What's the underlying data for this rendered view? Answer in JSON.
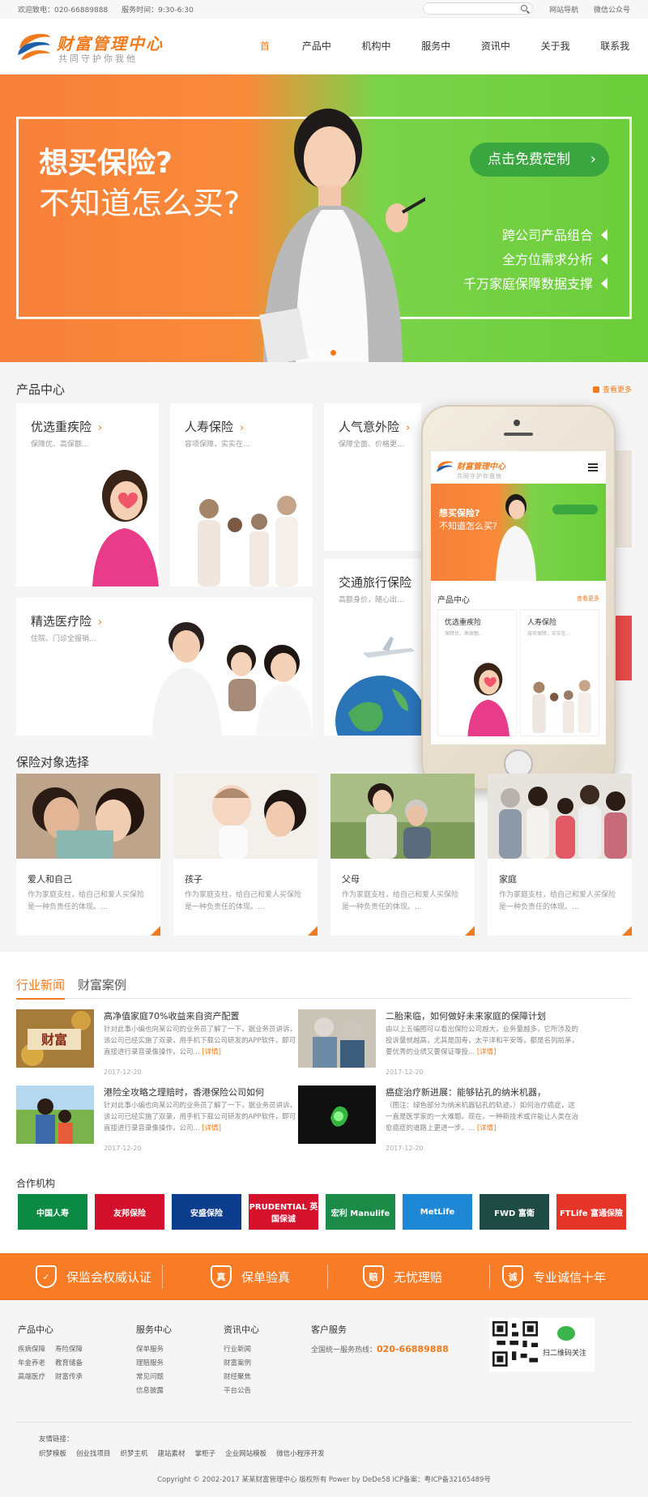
{
  "topbar": {
    "welcome": "欢迎致电：020-66889888",
    "hours": "服务时间：9:30-6:30",
    "site_nav": "网站导航",
    "wechat": "微信公众号"
  },
  "logo": {
    "title": "财富管理中心",
    "subtitle": "共同守护你我他"
  },
  "nav": [
    "首页",
    "产品中心",
    "机构中心",
    "服务中心",
    "资讯中心",
    "关于我们",
    "联系我们"
  ],
  "banner": {
    "q1": "想买保险?",
    "q2": "不知道怎么买?",
    "cta": "点击免费定制",
    "features": [
      "跨公司产品组合",
      "全方位需求分析",
      "千万家庭保障数据支撑"
    ]
  },
  "products": {
    "title": "产品中心",
    "more": "查看更多",
    "cards": [
      {
        "title": "优选重疾险",
        "desc": "保障优、高保额..."
      },
      {
        "title": "人寿保险",
        "desc": "容项保障，实实在..."
      },
      {
        "title": "人气意外险",
        "desc": "保障全面、价格更..."
      },
      {
        "title": "交通旅行保险",
        "desc": "高额身价，随心出..."
      },
      {
        "title": "精选医疗险",
        "desc": "住院、门诊全报销..."
      }
    ]
  },
  "phone": {
    "logo_title": "财富管理中心",
    "logo_sub": "共同守护你我他",
    "q1": "想买保险?",
    "q2": "不知道怎么买?",
    "sec": "产品中心",
    "more": "查看更多",
    "cards": [
      {
        "title": "优选重疾险",
        "desc": "保障优、高保额..."
      },
      {
        "title": "人寿保险",
        "desc": "容项保障，实实在..."
      }
    ]
  },
  "objects": {
    "title": "保险对象选择",
    "items": [
      {
        "title": "爱人和自己",
        "desc": "作为家庭支柱，给自己和爱人买保险是一种负责任的体现。..."
      },
      {
        "title": "孩子",
        "desc": "作为家庭支柱，给自己和爱人买保险是一种负责任的体现。..."
      },
      {
        "title": "父母",
        "desc": "作为家庭支柱，给自己和爱人买保险是一种负责任的体现。..."
      },
      {
        "title": "家庭",
        "desc": "作为家庭支柱，给自己和爱人买保险是一种负责任的体现。..."
      }
    ]
  },
  "news": {
    "tabs": [
      "行业新闻",
      "财富案例"
    ],
    "detail": "[详情]",
    "items": [
      {
        "title": "高净值家庭70%收益来自资产配置",
        "desc": "针对此事小编也向某公司的业务员了解了一下，据业务员讲诉，该公司已经实施了双录，用手机下载公司研发的APP软件，即可直接进行录音录像操作，公司...",
        "date": "2017-12-20",
        "img_label": "财富"
      },
      {
        "title": "二胎来临，如何做好未来家庭的保障计划",
        "desc": "由以上五幅图可以看出保险公司越大，业务量越多，它所涉及的投诉量就越高，尤其是国寿，太平洋和平安等，都是名列前茅，要优秀的业绩又要保证零投...",
        "date": "2017-12-20",
        "img_label": ""
      },
      {
        "title": "港险全攻略之理赔时，香港保险公司如何",
        "desc": "针对此事小编也向某公司的业务员了解了一下，据业务员讲诉，该公司已经实施了双录，用手机下载公司研发的APP软件，即可直接进行录音录像操作，公司...",
        "date": "2017-12-20",
        "img_label": ""
      },
      {
        "title": "癌症治疗新进展：能够钻孔的纳米机器，",
        "desc": "（图注：绿色部分为纳米机器钻孔的轨迹。）如何治疗癌症，这一直是医学家的一大难题。现在，一种新技术或许能让人类在治愈癌症的道路上更进一步。...",
        "date": "2017-12-20",
        "img_label": ""
      }
    ]
  },
  "partners": {
    "title": "合作机构",
    "items": [
      {
        "name": "中国人寿",
        "color": "#0b8a44"
      },
      {
        "name": "友邦保险",
        "color": "#d2102c"
      },
      {
        "name": "安盛保险",
        "color": "#0c3d8c"
      },
      {
        "name": "PRUDENTIAL 英国保诚",
        "color": "#d6112b"
      },
      {
        "name": "宏利 Manulife",
        "color": "#1b8b47"
      },
      {
        "name": "MetLife",
        "color": "#1f88d6"
      },
      {
        "name": "FWD 富衛",
        "color": "#1e4b43"
      },
      {
        "name": "FTLife 富通保險",
        "color": "#e53428"
      }
    ]
  },
  "strip": [
    {
      "icon": "✓",
      "label": "保监会权威认证"
    },
    {
      "icon": "真",
      "label": "保单验真"
    },
    {
      "icon": "赔",
      "label": "无忧理赔"
    },
    {
      "icon": "诚",
      "label": "专业诚信十年"
    }
  ],
  "footer": {
    "col1": {
      "title": "产品中心",
      "links": [
        "疾病保障",
        "寿险保障",
        "年金养老",
        "教育储备",
        "高端医疗",
        "财富传承"
      ]
    },
    "col2": {
      "title": "服务中心",
      "links": [
        "保单服务",
        "理赔服务",
        "常见问题",
        "信息披露"
      ]
    },
    "col3": {
      "title": "资讯中心",
      "links": [
        "行业新闻",
        "财富案例",
        "财经聚焦",
        "平台公告"
      ]
    },
    "col4": {
      "title": "客户服务",
      "hotline_label": "全国统一服务热线：",
      "hotline": "020-66889888"
    },
    "qr_label": "扫二维码关注",
    "friend_label": "友情链接：",
    "friend_links": [
      "织梦模板",
      "创业找项目",
      "织梦主机",
      "建站素材",
      "掌柜子",
      "企业网站模板",
      "微信小程序开发"
    ],
    "copyright": "Copyright © 2002-2017 某某财富管理中心 版权所有 Power by DeDe58 ICP备案：粤ICP备32165489号"
  }
}
